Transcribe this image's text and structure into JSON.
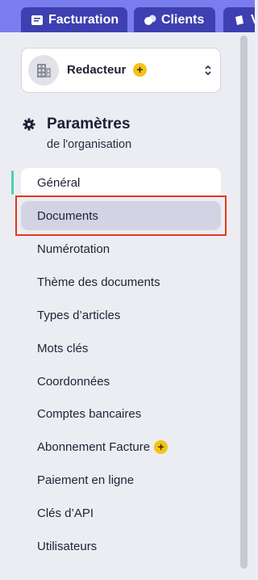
{
  "nav": {
    "tabs": [
      {
        "label": "Facturation",
        "icon": "document-icon"
      },
      {
        "label": "Clients",
        "icon": "users-icon"
      },
      {
        "label": "V",
        "icon": "cube-icon"
      }
    ]
  },
  "org": {
    "name": "Redacteur",
    "badge": "+",
    "avatar_icon": "building-icon"
  },
  "settings": {
    "title": "Paramètres",
    "subtitle": "de l'organisation"
  },
  "menu": {
    "items": [
      {
        "label": "Général"
      },
      {
        "label": "Documents"
      },
      {
        "label": "Numérotation"
      },
      {
        "label": "Thème des documents"
      },
      {
        "label": "Types d’articles"
      },
      {
        "label": "Mots clés"
      },
      {
        "label": "Coordonnées"
      },
      {
        "label": "Comptes bancaires"
      },
      {
        "label": "Abonnement Facture",
        "badge": "+"
      },
      {
        "label": "Paiement en ligne"
      },
      {
        "label": "Clés d’API"
      },
      {
        "label": "Utilisateurs"
      }
    ]
  },
  "colors": {
    "topbar": "#7a7dee",
    "tab": "#3e3fb0",
    "accent_green": "#4cd3a6",
    "selected_bg": "#d3d3e3",
    "highlight": "#e4391b",
    "badge": "#f3c316"
  }
}
